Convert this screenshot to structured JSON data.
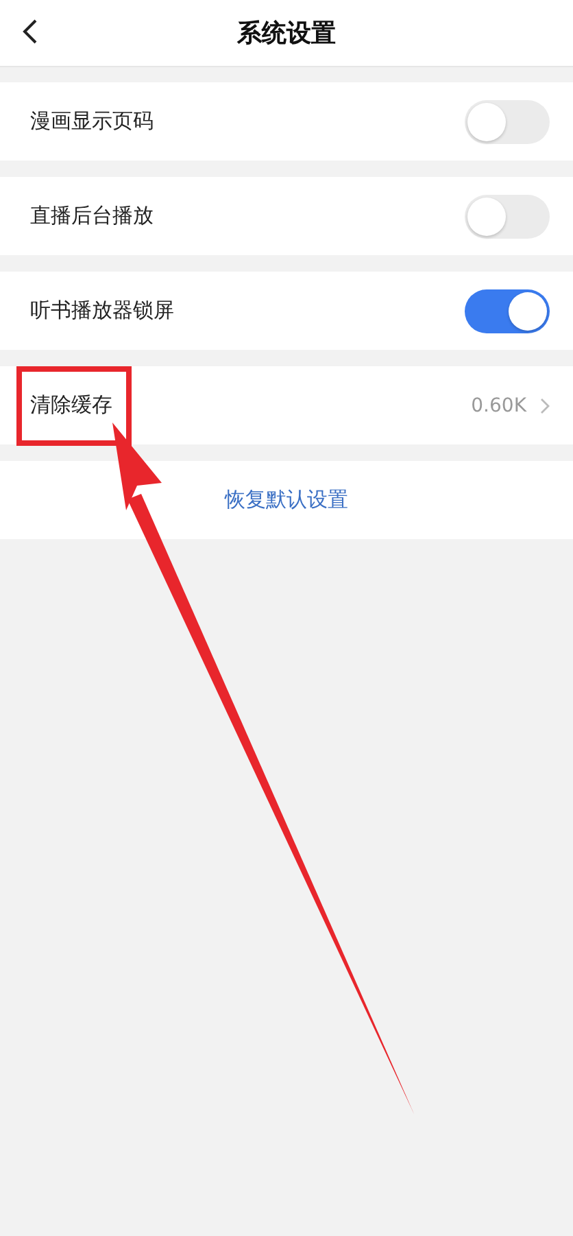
{
  "header": {
    "title": "系统设置"
  },
  "settings": [
    {
      "kind": "toggle",
      "label": "漫画显示页码",
      "on": false,
      "highlighted": false
    },
    {
      "kind": "toggle",
      "label": "直播后台播放",
      "on": false,
      "highlighted": false
    },
    {
      "kind": "toggle",
      "label": "听书播放器锁屏",
      "on": true,
      "highlighted": false
    },
    {
      "kind": "value",
      "label": "清除缓存",
      "value": "0.60K",
      "highlighted": true
    }
  ],
  "reset_button": {
    "label": "恢复默认设置"
  }
}
